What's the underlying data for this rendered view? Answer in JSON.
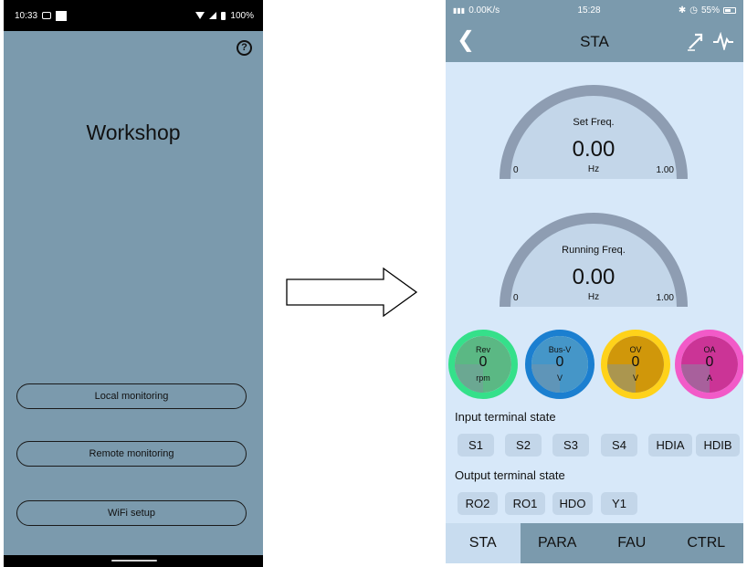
{
  "left_phone": {
    "status_bar": {
      "time": "10:33",
      "battery": "100%"
    },
    "title": "Workshop",
    "buttons": [
      "Local monitoring",
      "Remote monitoring",
      "WiFi setup"
    ]
  },
  "right_phone": {
    "status_bar": {
      "net_speed": "0.00K/s",
      "time": "15:28",
      "battery": "55%"
    },
    "header": {
      "title": "STA"
    },
    "gauges": [
      {
        "label": "Set Freq.",
        "value": "0.00",
        "unit": "Hz",
        "min": "0",
        "max": "1.00"
      },
      {
        "label": "Running Freq.",
        "value": "0.00",
        "unit": "Hz",
        "min": "0",
        "max": "1.00"
      }
    ],
    "indicators": [
      {
        "name": "Rev",
        "value": "0",
        "unit": "rpm",
        "fill": "#5bb884",
        "ring": "#35e08a",
        "base": "#7e96a4"
      },
      {
        "name": "Bus-V",
        "value": "0",
        "unit": "V",
        "fill": "#4596c8",
        "ring": "#1b7fd0",
        "base": "#7e96a4"
      },
      {
        "name": "OV",
        "value": "0",
        "unit": "V",
        "fill": "#d0970a",
        "ring": "#ffd21a",
        "base": "#7e96a4"
      },
      {
        "name": "OA",
        "value": "0",
        "unit": "A",
        "fill": "#cb3496",
        "ring": "#f25ac8",
        "base": "#7e96a4"
      }
    ],
    "input_section": {
      "title": "Input terminal state",
      "terminals": [
        "S1",
        "S2",
        "S3",
        "S4",
        "HDIA",
        "HDIB"
      ]
    },
    "output_section": {
      "title": "Output terminal state",
      "terminals": [
        "RO2",
        "RO1",
        "HDO",
        "Y1"
      ]
    },
    "tabs": [
      "STA",
      "PARA",
      "FAU",
      "CTRL"
    ],
    "colors": {
      "bar": "#7b9aad",
      "background": "#d7e8f9",
      "gauge_arc": "#8e9db2",
      "gauge_face": "#c3d6e9",
      "terminal_box": "#c3d6e9"
    }
  }
}
